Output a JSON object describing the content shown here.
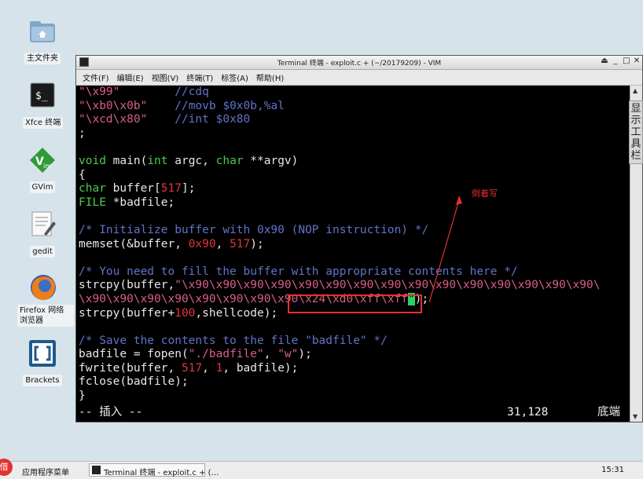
{
  "desktop": {
    "icons": [
      {
        "label": "主文件夹"
      },
      {
        "label": "Xfce 终端"
      },
      {
        "label": "GVim"
      },
      {
        "label": "gedit"
      },
      {
        "label": "Firefox 网络浏览器"
      },
      {
        "label": "Brackets"
      }
    ]
  },
  "window": {
    "title": "Terminal 终端 - exploit.c + (~/20179209) - VIM",
    "controls": {
      "shade": "⏏",
      "min": "_",
      "max": "□",
      "close": "✕"
    },
    "menu": [
      "文件(F)",
      "编辑(E)",
      "视图(V)",
      "终端(T)",
      "标签(A)",
      "帮助(H)"
    ],
    "side_tab": "显示工具栏"
  },
  "editor": {
    "status_mode": "-- 插入 --",
    "status_pos": "31,128",
    "status_scroll": "底端"
  },
  "annotation": {
    "text": "倒着写"
  },
  "taskbar": {
    "app_menu": "应用程序菜单",
    "task_label": "Terminal 终端 - exploit.c + (…",
    "clock": "15:31",
    "badge": "借"
  },
  "colors": {
    "accent_red": "#e53030",
    "string": "#d75f87",
    "comment": "#6272c9",
    "keyword": "#4ec94e",
    "number": "#e0353a"
  }
}
